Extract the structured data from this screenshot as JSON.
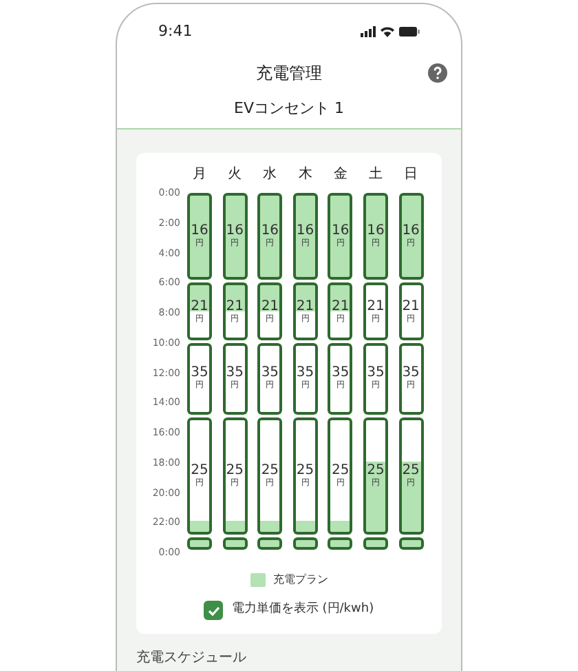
{
  "status_bar": {
    "time": "9:41"
  },
  "header": {
    "title": "充電管理",
    "subtitle": "EVコンセント 1"
  },
  "schedule": {
    "days": [
      "月",
      "火",
      "水",
      "木",
      "金",
      "土",
      "日"
    ],
    "time_labels": [
      "0:00",
      "2:00",
      "4:00",
      "6:00",
      "8:00",
      "10:00",
      "12:00",
      "14:00",
      "16:00",
      "18:00",
      "20:00",
      "22:00",
      "0:00"
    ],
    "columns": [
      {
        "segments": [
          {
            "price": "16",
            "unit": "円",
            "level": 1,
            "kind": "top"
          },
          {
            "price": "21",
            "unit": "円",
            "level": 0.5,
            "kind": "top"
          },
          {
            "price": "35",
            "unit": "円",
            "kind": "empty"
          },
          {
            "level": 0.125,
            "price": "25",
            "unit": "円",
            "kind": "bottom"
          },
          {
            "kind": "full"
          }
        ]
      },
      {
        "segments": [
          {
            "price": "16",
            "unit": "円",
            "level": 1,
            "kind": "top"
          },
          {
            "price": "21",
            "unit": "円",
            "level": 0.5,
            "kind": "top"
          },
          {
            "price": "35",
            "unit": "円",
            "kind": "empty"
          },
          {
            "level": 0.125,
            "price": "25",
            "unit": "円",
            "kind": "bottom"
          },
          {
            "kind": "full"
          }
        ]
      },
      {
        "segments": [
          {
            "price": "16",
            "unit": "円",
            "level": 1,
            "kind": "top"
          },
          {
            "price": "21",
            "unit": "円",
            "level": 0.5,
            "kind": "top"
          },
          {
            "price": "35",
            "unit": "円",
            "kind": "empty"
          },
          {
            "level": 0.125,
            "price": "25",
            "unit": "円",
            "kind": "bottom"
          },
          {
            "kind": "full"
          }
        ]
      },
      {
        "segments": [
          {
            "price": "16",
            "unit": "円",
            "level": 1,
            "kind": "top"
          },
          {
            "price": "21",
            "unit": "円",
            "level": 0.5,
            "kind": "top"
          },
          {
            "price": "35",
            "unit": "円",
            "kind": "empty"
          },
          {
            "level": 0.125,
            "price": "25",
            "unit": "円",
            "kind": "bottom"
          },
          {
            "kind": "full"
          }
        ]
      },
      {
        "segments": [
          {
            "price": "16",
            "unit": "円",
            "level": 1,
            "kind": "top"
          },
          {
            "price": "21",
            "unit": "円",
            "level": 0.5,
            "kind": "top"
          },
          {
            "price": "35",
            "unit": "円",
            "kind": "empty"
          },
          {
            "level": 0.125,
            "price": "25",
            "unit": "円",
            "kind": "bottom"
          },
          {
            "kind": "full"
          }
        ]
      },
      {
        "segments": [
          {
            "price": "16",
            "unit": "円",
            "level": 1,
            "kind": "top"
          },
          {
            "price": "21",
            "unit": "円",
            "kind": "empty"
          },
          {
            "price": "35",
            "unit": "円",
            "kind": "empty"
          },
          {
            "level": 0.625,
            "price": "25",
            "unit": "円",
            "kind": "bottom"
          },
          {
            "kind": "full"
          }
        ]
      },
      {
        "segments": [
          {
            "price": "16",
            "unit": "円",
            "level": 1,
            "kind": "top"
          },
          {
            "price": "21",
            "unit": "円",
            "kind": "empty"
          },
          {
            "price": "35",
            "unit": "円",
            "kind": "empty"
          },
          {
            "level": 0.625,
            "price": "25",
            "unit": "円",
            "kind": "bottom"
          },
          {
            "kind": "full"
          }
        ]
      }
    ],
    "legend": "充電プラン",
    "show_prices": {
      "label": "電力単価を表示 (円/kwh)",
      "checked": true
    }
  },
  "section_heading": "充電スケジュール"
}
